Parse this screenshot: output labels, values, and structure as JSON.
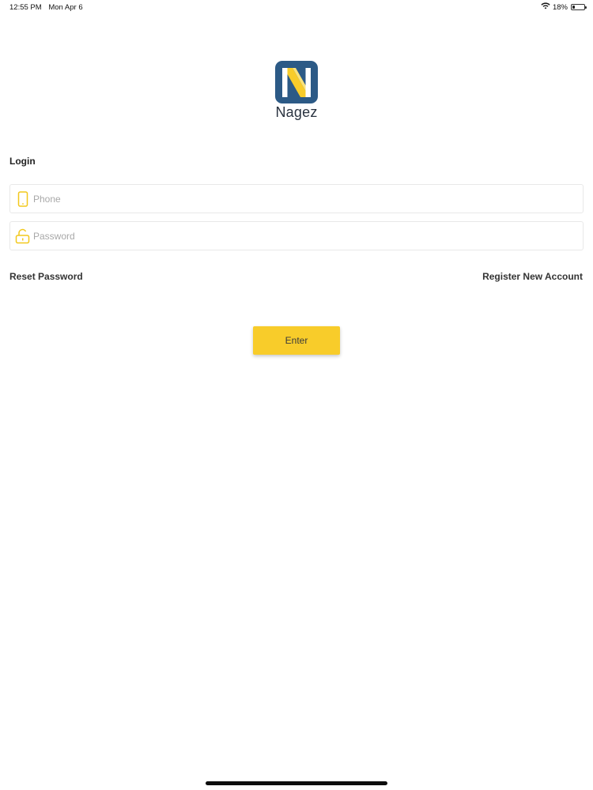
{
  "status_bar": {
    "time": "12:55 PM",
    "date": "Mon Apr 6",
    "battery_percent_label": "18%",
    "battery_level": 0.18,
    "wifi_icon": "wifi-icon",
    "battery_icon": "battery-icon"
  },
  "brand": {
    "name": "Nagez",
    "logo_icon": "nagez-logo-icon",
    "colors": {
      "logo_background": "#2c5a86",
      "logo_accent": "#f8cc2a"
    }
  },
  "login": {
    "title": "Login",
    "phone": {
      "placeholder": "Phone",
      "value": "",
      "icon": "phone-icon"
    },
    "password": {
      "placeholder": "Password",
      "value": "",
      "icon": "lock-icon"
    },
    "reset_password_label": "Reset Password",
    "register_label": "Register New Account",
    "enter_label": "Enter"
  },
  "colors": {
    "accent": "#f8cc2a",
    "icon_accent": "#f2c81c"
  }
}
